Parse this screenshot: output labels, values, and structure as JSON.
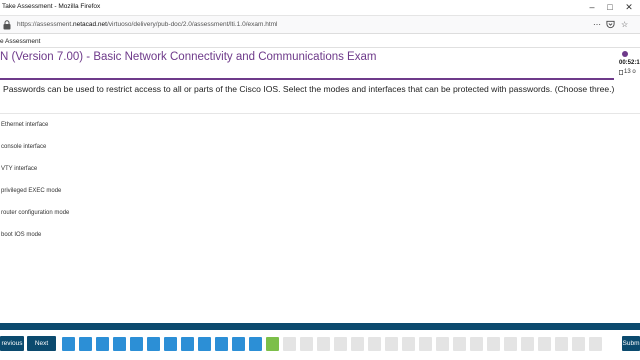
{
  "window": {
    "title": "Take Assessment - Mozilla Firefox"
  },
  "browser": {
    "url_prefix": "https://assessment.",
    "url_domain": "netacad.net",
    "url_suffix": "/virtuoso/delivery/pub-doc/2.0/assessment/lti.1.0/exam.html",
    "more_icon": "⋯",
    "pocket_icon": "pocket-icon",
    "star_icon": "☆"
  },
  "page_header": {
    "label": "e Assessment"
  },
  "exam": {
    "title": "N (Version 7.00) - Basic Network Connectivity and Communications Exam"
  },
  "timer": {
    "time": "00:52:1",
    "count": "13 o"
  },
  "question": {
    "text": "Passwords can be used to restrict access to all or parts of the Cisco IOS. Select the modes and interfaces that can be protected with passwords. (Choose three.)",
    "options": [
      "Ethernet interface",
      "console interface",
      "VTY interface",
      "privileged EXEC mode",
      "router configuration mode",
      "boot IOS mode"
    ]
  },
  "footer": {
    "previous_label": "revious",
    "next_label": "Next",
    "submit_label": "Subm",
    "question_boxes": [
      "done",
      "done",
      "done",
      "done",
      "done",
      "done",
      "done",
      "done",
      "done",
      "done",
      "done",
      "done",
      "current",
      "todo",
      "todo",
      "todo",
      "todo",
      "todo",
      "todo",
      "todo",
      "todo",
      "todo",
      "todo",
      "todo",
      "todo",
      "todo",
      "todo",
      "todo",
      "todo",
      "todo",
      "todo",
      "todo"
    ]
  },
  "colors": {
    "accent_purple": "#6e3a8a",
    "nav_blue": "#0b4a6e",
    "answered_blue": "#2c8fd6",
    "current_green": "#7cbf4a",
    "unanswered_gray": "#e4e4e4"
  }
}
